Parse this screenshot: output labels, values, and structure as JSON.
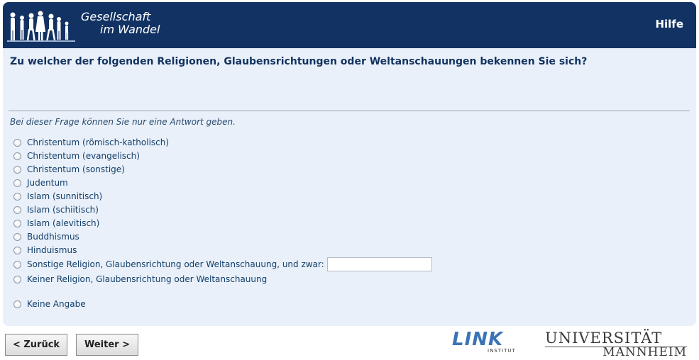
{
  "header": {
    "brand_line1": "Gesellschaft",
    "brand_line2": "im Wandel",
    "help_label": "Hilfe"
  },
  "question": {
    "text": "Zu welcher der folgenden Religionen, Glaubensrichtungen oder Weltanschauungen bekennen Sie sich?",
    "instruction": "Bei dieser Frage können Sie nur eine Antwort geben."
  },
  "options": [
    {
      "label": "Christentum (römisch-katholisch)"
    },
    {
      "label": "Christentum (evangelisch)"
    },
    {
      "label": "Christentum (sonstige)"
    },
    {
      "label": "Judentum"
    },
    {
      "label": "Islam (sunnitisch)"
    },
    {
      "label": "Islam (schiitisch)"
    },
    {
      "label": "Islam (alevitisch)"
    },
    {
      "label": "Buddhismus"
    },
    {
      "label": "Hinduismus"
    },
    {
      "label": "Sonstige Religion, Glaubensrichtung oder Weltanschauung, und zwar:"
    },
    {
      "label": "Keiner Religion, Glaubensrichtung oder Weltanschauung"
    },
    {
      "label": "Keine Angabe"
    }
  ],
  "other_input": {
    "value": "",
    "placeholder": ""
  },
  "nav": {
    "back_label": "< Zurück",
    "next_label": "Weiter >"
  },
  "footer": {
    "link_logo": "LINK",
    "link_sub": "INSTITUT",
    "uni_line1": "UNIVERSITÄT",
    "uni_line2": "MANNHEIM"
  },
  "colors": {
    "header_bg": "#123263",
    "panel_bg": "#e9f0f9",
    "text": "#123e6a"
  }
}
